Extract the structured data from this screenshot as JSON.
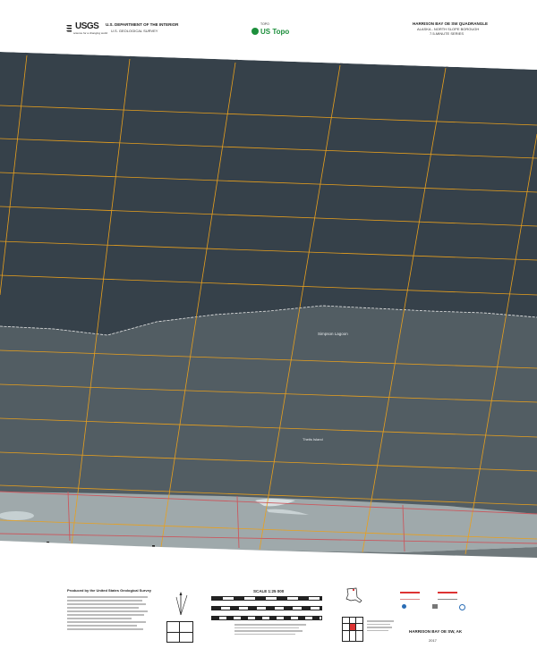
{
  "header": {
    "agency_logo": "USGS",
    "agency_tagline": "science for a changing world",
    "department": "U.S. DEPARTMENT OF THE INTERIOR",
    "survey": "U.S. GEOLOGICAL SURVEY",
    "series_top": "TOPO",
    "series_name": "US Topo",
    "quad_title": "HARRISON BAY OE SW QUADRANGLE",
    "quad_sub1": "ALASKA - NORTH SLOPE BOROUGH",
    "quad_sub2": "7.5-MINUTE SERIES"
  },
  "map_labels": {
    "water_feature": "Simpson Lagoon",
    "place": "Thetis Island"
  },
  "footer": {
    "credits_title": "Produced by the United States Geological Survey",
    "scale_title": "SCALE 1:25 000",
    "quad_name": "HARRISON BAY OE SW, AK",
    "year": "2017"
  },
  "colors": {
    "ocean_deep": "#36414a",
    "ocean_shallow": "#525d63",
    "beach": "#9aa4a6",
    "grid_orange": "#e8a01e",
    "grid_red": "#c9595f",
    "seal_green": "#1d8f3c"
  },
  "icons": [
    "usgs-logo",
    "us-topo-seal",
    "north-arrow",
    "alaska-locator",
    "road-legend"
  ]
}
